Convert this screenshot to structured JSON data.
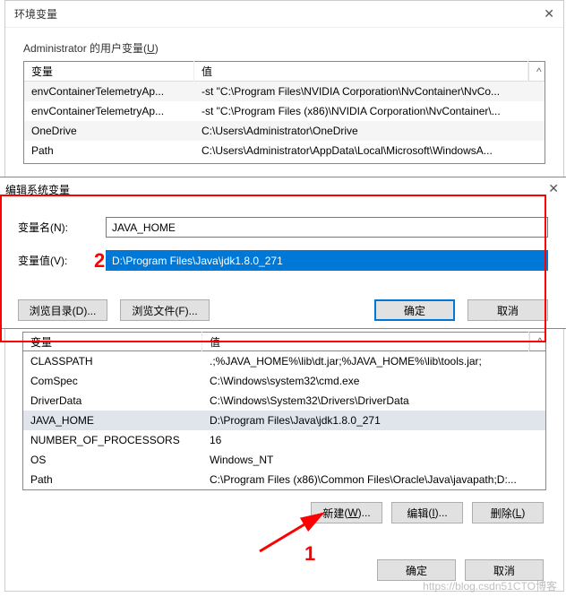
{
  "dialog1": {
    "title": "环境变量",
    "user_section_label": "Administrator 的用户变量",
    "user_section_key": "U",
    "headers": {
      "variable": "变量",
      "value": "值"
    },
    "user_rows": [
      {
        "var": "envContainerTelemetryAp...",
        "val": "-st \"C:\\Program Files\\NVIDIA Corporation\\NvContainer\\NvCo..."
      },
      {
        "var": "envContainerTelemetryAp...",
        "val": "-st \"C:\\Program Files (x86)\\NVIDIA Corporation\\NvContainer\\..."
      },
      {
        "var": "OneDrive",
        "val": "C:\\Users\\Administrator\\OneDrive"
      },
      {
        "var": "Path",
        "val": "C:\\Users\\Administrator\\AppData\\Local\\Microsoft\\WindowsA..."
      }
    ],
    "sys_header": {
      "variable": "变量",
      "value": "值"
    },
    "sys_rows": [
      {
        "var": "CLASSPATH",
        "val": ".;%JAVA_HOME%\\lib\\dt.jar;%JAVA_HOME%\\lib\\tools.jar;"
      },
      {
        "var": "ComSpec",
        "val": "C:\\Windows\\system32\\cmd.exe"
      },
      {
        "var": "DriverData",
        "val": "C:\\Windows\\System32\\Drivers\\DriverData"
      },
      {
        "var": "JAVA_HOME",
        "val": "D:\\Program Files\\Java\\jdk1.8.0_271"
      },
      {
        "var": "NUMBER_OF_PROCESSORS",
        "val": "16"
      },
      {
        "var": "OS",
        "val": "Windows_NT"
      },
      {
        "var": "Path",
        "val": "C:\\Program Files (x86)\\Common Files\\Oracle\\Java\\javapath;D:..."
      }
    ],
    "buttons": {
      "new": "新建",
      "new_key": "W",
      "edit": "编辑",
      "edit_key": "I",
      "delete": "删除",
      "delete_key": "L",
      "ok": "确定",
      "cancel": "取消"
    }
  },
  "dialog2": {
    "title": "编辑系统变量",
    "name_label": "变量名(N):",
    "name_value": "JAVA_HOME",
    "value_label": "变量值(V):",
    "value_value": "D:\\Program Files\\Java\\jdk1.8.0_271",
    "browse_dir": "浏览目录(D)...",
    "browse_file": "浏览文件(F)...",
    "ok": "确定",
    "cancel": "取消"
  },
  "annotations": {
    "n1": "1",
    "n2": "2"
  },
  "watermark": "https://blog.csdn51CTO博客"
}
